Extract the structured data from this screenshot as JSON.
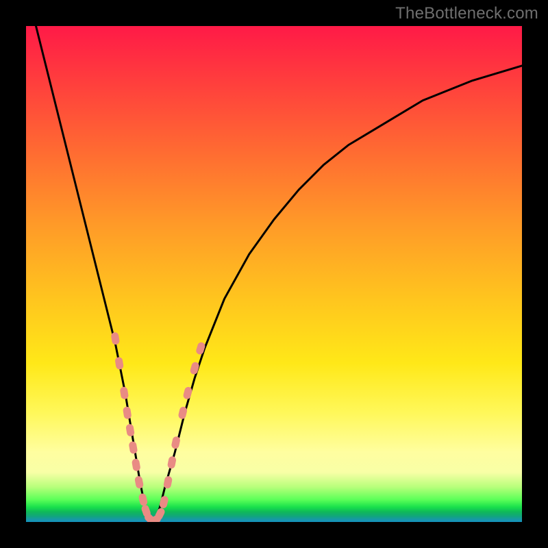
{
  "watermark": "TheBottleneck.com",
  "colors": {
    "frame": "#000000",
    "curve": "#000000",
    "marker_fill": "#e98b84",
    "marker_stroke": "#e98b84"
  },
  "chart_data": {
    "type": "line",
    "title": "",
    "xlabel": "",
    "ylabel": "",
    "xlim": [
      0,
      100
    ],
    "ylim": [
      0,
      100
    ],
    "grid": false,
    "legend": false,
    "series": [
      {
        "name": "bottleneck-curve",
        "x": [
          2,
          4,
          6,
          8,
          10,
          12,
          14,
          16,
          18,
          20,
          21,
          22,
          23,
          24,
          25,
          26,
          27,
          28,
          30,
          32,
          34,
          36,
          40,
          45,
          50,
          55,
          60,
          65,
          70,
          75,
          80,
          85,
          90,
          95,
          100
        ],
        "y": [
          100,
          92,
          84,
          76,
          68,
          60,
          52,
          44,
          36,
          26,
          20,
          14,
          8,
          3,
          0,
          0,
          3,
          7,
          14,
          22,
          29,
          35,
          45,
          54,
          61,
          67,
          72,
          76,
          79,
          82,
          85,
          87,
          89,
          90.5,
          92
        ]
      }
    ],
    "markers": [
      {
        "x": 18.0,
        "y": 37.0
      },
      {
        "x": 18.8,
        "y": 32.0
      },
      {
        "x": 19.8,
        "y": 26.0
      },
      {
        "x": 20.4,
        "y": 22.0
      },
      {
        "x": 21.0,
        "y": 18.5
      },
      {
        "x": 21.6,
        "y": 15.0
      },
      {
        "x": 22.2,
        "y": 11.5
      },
      {
        "x": 22.8,
        "y": 8.0
      },
      {
        "x": 23.6,
        "y": 4.5
      },
      {
        "x": 24.2,
        "y": 2.2
      },
      {
        "x": 25.0,
        "y": 0.6
      },
      {
        "x": 26.0,
        "y": 0.4
      },
      {
        "x": 27.0,
        "y": 1.6
      },
      {
        "x": 27.8,
        "y": 4.0
      },
      {
        "x": 28.6,
        "y": 8.0
      },
      {
        "x": 29.4,
        "y": 12.0
      },
      {
        "x": 30.2,
        "y": 16.0
      },
      {
        "x": 31.6,
        "y": 22.0
      },
      {
        "x": 32.6,
        "y": 26.0
      },
      {
        "x": 34.0,
        "y": 31.0
      },
      {
        "x": 35.2,
        "y": 35.0
      }
    ]
  }
}
